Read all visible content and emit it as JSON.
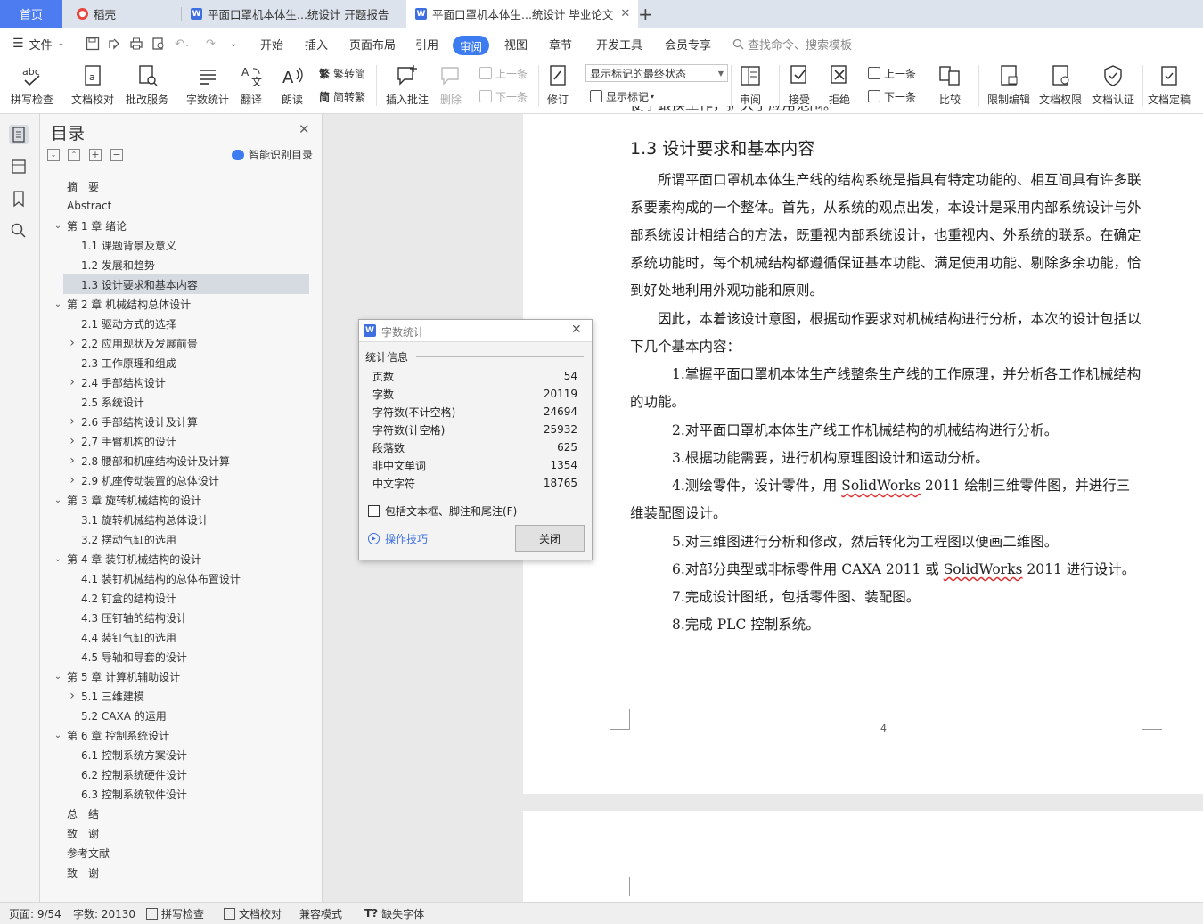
{
  "tabs": {
    "home": "首页",
    "items": [
      {
        "label": "稻壳",
        "icon": "docer-icon",
        "color": "#e8453c"
      },
      {
        "label": "平面口罩机本体生...统设计 开题报告",
        "icon": "word-doc-icon",
        "color": "#3d6fe0"
      },
      {
        "label": "平面口罩机本体生...统设计 毕业论文",
        "icon": "word-doc-icon",
        "color": "#3d6fe0"
      }
    ],
    "add": "+"
  },
  "menu": {
    "file": "文件",
    "items": [
      "开始",
      "插入",
      "页面布局",
      "引用",
      "审阅",
      "视图",
      "章节",
      "开发工具",
      "会员专享"
    ],
    "active": "审阅",
    "search_placeholder": "查找命令、搜索模板"
  },
  "ribbon": {
    "spell": "拼写检查",
    "proofread": "文档校对",
    "batch_service": "批改服务",
    "word_count": "字数统计",
    "translate": "翻译",
    "read_aloud": "朗读",
    "to_traditional": "繁转简",
    "to_simplified": "简转繁",
    "insert_comment": "插入批注",
    "delete": "删除",
    "prev": "上一条",
    "next": "下一条",
    "revise": "修订",
    "display_mode": "显示标记的最终状态",
    "show_marks": "显示标记",
    "review": "审阅",
    "accept": "接受",
    "reject": "拒绝",
    "prev2": "上一条",
    "next2": "下一条",
    "compare": "比较",
    "restrict_edit": "限制编辑",
    "doc_permission": "文档权限",
    "doc_cert": "文档认证",
    "doc_finalize": "文档定稿"
  },
  "toc": {
    "title": "目录",
    "smart": "智能识别目录",
    "items": [
      {
        "label": "摘　要",
        "level": 0,
        "arrow": ""
      },
      {
        "label": "Abstract",
        "level": 0,
        "arrow": ""
      },
      {
        "label": "第 1 章  绪论",
        "level": 0,
        "arrow": "v"
      },
      {
        "label": "1.1  课题背景及意义",
        "level": 1,
        "arrow": ""
      },
      {
        "label": "1.2  发展和趋势",
        "level": 1,
        "arrow": ""
      },
      {
        "label": "1.3  设计要求和基本内容",
        "level": 1,
        "arrow": "",
        "selected": true
      },
      {
        "label": "第 2 章  机械结构总体设计",
        "level": 0,
        "arrow": "v"
      },
      {
        "label": "2.1  驱动方式的选择",
        "level": 1,
        "arrow": ""
      },
      {
        "label": "2.2  应用现状及发展前景",
        "level": 1,
        "arrow": ">"
      },
      {
        "label": "2.3  工作原理和组成",
        "level": 1,
        "arrow": ""
      },
      {
        "label": "2.4 手部结构设计",
        "level": 1,
        "arrow": ">"
      },
      {
        "label": "2.5 系统设计",
        "level": 1,
        "arrow": ""
      },
      {
        "label": "2.6 手部结构设计及计算",
        "level": 1,
        "arrow": ">"
      },
      {
        "label": "2.7 手臂机构的设计",
        "level": 1,
        "arrow": ">"
      },
      {
        "label": "2.8 腰部和机座结构设计及计算",
        "level": 1,
        "arrow": ">"
      },
      {
        "label": "2.9 机座传动装置的总体设计",
        "level": 1,
        "arrow": ">"
      },
      {
        "label": "第 3 章  旋转机械结构的设计",
        "level": 0,
        "arrow": "v"
      },
      {
        "label": "3.1 旋转机械结构总体设计",
        "level": 1,
        "arrow": ""
      },
      {
        "label": "3.2 摆动气缸的选用",
        "level": 1,
        "arrow": ""
      },
      {
        "label": "第 4 章  装钉机械结构的设计",
        "level": 0,
        "arrow": "v"
      },
      {
        "label": "4.1  装钉机械结构的总体布置设计",
        "level": 1,
        "arrow": ""
      },
      {
        "label": "4.2 钉盒的结构设计",
        "level": 1,
        "arrow": ""
      },
      {
        "label": "4.3 压钉轴的结构设计",
        "level": 1,
        "arrow": ""
      },
      {
        "label": "4.4 装钉气缸的选用",
        "level": 1,
        "arrow": ""
      },
      {
        "label": "4.5 导轴和导套的设计",
        "level": 1,
        "arrow": ""
      },
      {
        "label": "第 5 章  计算机辅助设计",
        "level": 0,
        "arrow": "v"
      },
      {
        "label": "5.1  三维建模",
        "level": 1,
        "arrow": ">"
      },
      {
        "label": "5.2 CAXA 的运用",
        "level": 1,
        "arrow": ""
      },
      {
        "label": "第 6 章  控制系统设计",
        "level": 0,
        "arrow": "v"
      },
      {
        "label": "6.1 控制系统方案设计",
        "level": 1,
        "arrow": ""
      },
      {
        "label": "6.2 控制系统硬件设计",
        "level": 1,
        "arrow": ""
      },
      {
        "label": "6.3 控制系统软件设计",
        "level": 1,
        "arrow": ""
      },
      {
        "label": "总　结",
        "level": 0,
        "arrow": ""
      },
      {
        "label": "致　谢",
        "level": 0,
        "arrow": ""
      },
      {
        "label": "参考文献",
        "level": 0,
        "arrow": ""
      },
      {
        "label": "致　谢",
        "level": 0,
        "arrow": ""
      }
    ]
  },
  "dialog": {
    "title": "字数统计",
    "section": "统计信息",
    "rows": [
      {
        "label": "页数",
        "value": "54"
      },
      {
        "label": "字数",
        "value": "20119"
      },
      {
        "label": "字符数(不计空格)",
        "value": "24694"
      },
      {
        "label": "字符数(计空格)",
        "value": "25932"
      },
      {
        "label": "段落数",
        "value": "625"
      },
      {
        "label": "非中文单词",
        "value": "1354"
      },
      {
        "label": "中文字符",
        "value": "18765"
      }
    ],
    "checkbox": "包括文本框、脚注和尾注(F)",
    "tips": "操作技巧",
    "close": "关闭"
  },
  "document": {
    "clipped_top": "使于跟换工作，扩大了应用范围。",
    "heading": "1.3  设计要求和基本内容",
    "para1": "所谓平面口罩机本体生产线的结构系统是指具有特定功能的、相互间具有许多联系要素构成的一个整体。首先，从系统的观点出发，本设计是采用内部系统设计与外部系统设计相结合的方法，既重视内部系统设计，也重视内、外系统的联系。在确定系统功能时，每个机械结构都遵循保证基本功能、满足使用功能、剔除多余功能，恰到好处地利用外观功能和原则。",
    "para2": "因此，本着该设计意图，根据动作要求对机械结构进行分析，本次的设计包括以下几个基本内容：",
    "list": [
      "1.掌握平面口罩机本体生产线整条生产线的工作原理，并分析各工作机械结构的功能。",
      "2.对平面口罩机本体生产线工作机械结构的机械结构进行分析。",
      "3.根据功能需要，进行机构原理图设计和运动分析。",
      "4.测绘零件，设计零件，用 SolidWorks 2011 绘制三维零件图，并进行三维装配图设计。",
      "5.对三维图进行分析和修改，然后转化为工程图以便画二维图。",
      "6.对部分典型或非标零件用 CAXA 2011 或 SolidWorks 2011 进行设计。",
      "7.完成设计图纸，包括零件图、装配图。",
      "8.完成 PLC 控制系统。"
    ],
    "page_number": "4"
  },
  "status": {
    "page": "页面: 9/54",
    "words": "字数: 20130",
    "spell": "拼写检查",
    "proof": "文档校对",
    "compat": "兼容模式",
    "missing_font": "缺失字体"
  }
}
